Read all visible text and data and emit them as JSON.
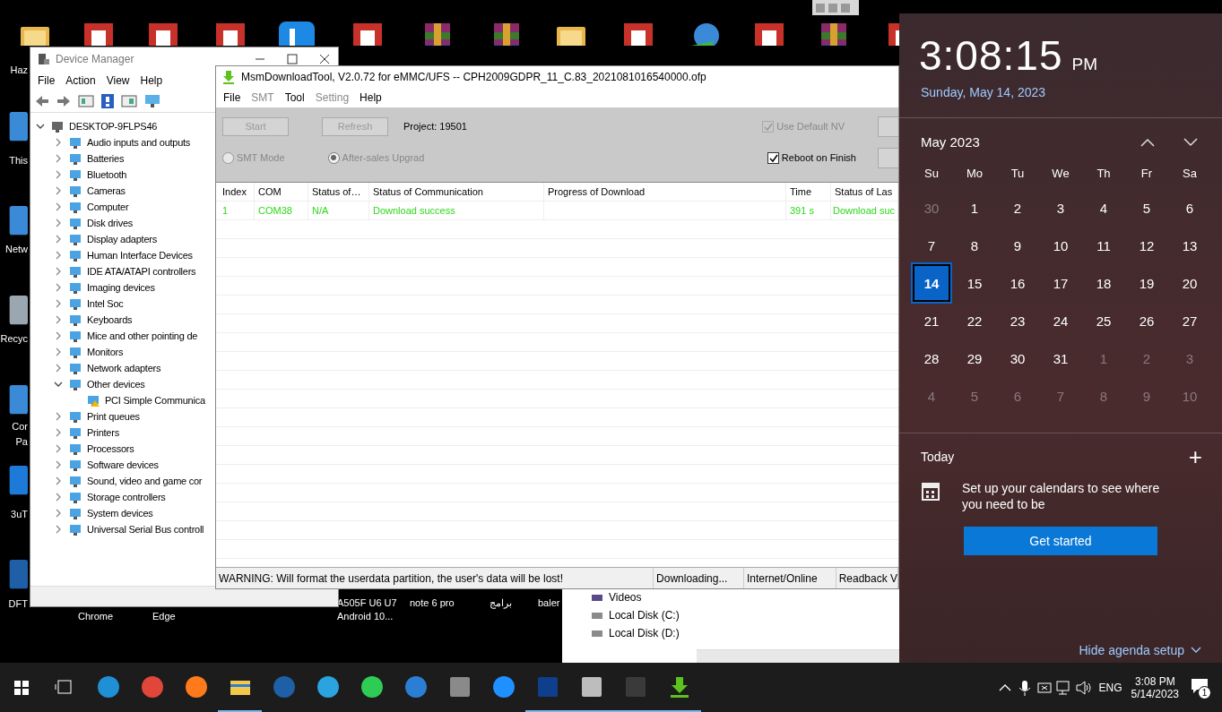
{
  "desktop": {
    "labels": [
      "Haz",
      "This",
      "Netw",
      "Recyc",
      "Cor",
      "Pa",
      "3uT",
      "DFT",
      "Chrome",
      "Edge",
      "A505F U6 U7",
      "Android 10...",
      "note 6 pro",
      "برامج",
      "baler"
    ]
  },
  "device_manager": {
    "title": "Device Manager",
    "menu": [
      "File",
      "Action",
      "View",
      "Help"
    ],
    "tree": [
      {
        "label": "DESKTOP-9FLPS46",
        "expanded": true,
        "children": [
          {
            "label": "Audio inputs and outputs",
            "expanded": false
          },
          {
            "label": "Batteries",
            "expanded": false
          },
          {
            "label": "Bluetooth",
            "expanded": false
          },
          {
            "label": "Cameras",
            "expanded": false
          },
          {
            "label": "Computer",
            "expanded": false
          },
          {
            "label": "Disk drives",
            "expanded": false
          },
          {
            "label": "Display adapters",
            "expanded": false
          },
          {
            "label": "Human Interface Devices",
            "expanded": false
          },
          {
            "label": "IDE ATA/ATAPI controllers",
            "expanded": false
          },
          {
            "label": "Imaging devices",
            "expanded": false
          },
          {
            "label": "Intel Soc",
            "expanded": false
          },
          {
            "label": "Keyboards",
            "expanded": false
          },
          {
            "label": "Mice and other pointing de",
            "expanded": false
          },
          {
            "label": "Monitors",
            "expanded": false
          },
          {
            "label": "Network adapters",
            "expanded": false
          },
          {
            "label": "Other devices",
            "expanded": true,
            "children": [
              {
                "label": "PCI Simple Communica",
                "warning": true
              }
            ]
          },
          {
            "label": "Print queues",
            "expanded": false
          },
          {
            "label": "Printers",
            "expanded": false
          },
          {
            "label": "Processors",
            "expanded": false
          },
          {
            "label": "Software devices",
            "expanded": false
          },
          {
            "label": "Sound, video and game cor",
            "expanded": false
          },
          {
            "label": "Storage controllers",
            "expanded": false
          },
          {
            "label": "System devices",
            "expanded": false
          },
          {
            "label": "Universal Serial Bus controll",
            "expanded": false
          }
        ]
      }
    ]
  },
  "msm_tool": {
    "title": "MsmDownloadTool, V2.0.72 for eMMC/UFS -- CPH2009GDPR_11_C.83_2021081016540000.ofp",
    "menu": [
      {
        "label": "File",
        "disabled": false
      },
      {
        "label": "SMT",
        "disabled": true
      },
      {
        "label": "Tool",
        "disabled": false
      },
      {
        "label": "Setting",
        "disabled": true
      },
      {
        "label": "Help",
        "disabled": false
      }
    ],
    "buttons": [
      {
        "label": "Start",
        "disabled": true
      },
      {
        "label": "Refresh",
        "disabled": true
      }
    ],
    "project": "Project: 19501",
    "use_default_nv": {
      "label": "Use Default NV",
      "checked": true,
      "disabled": true
    },
    "modes": [
      {
        "label": "SMT Mode",
        "selected": false
      },
      {
        "label": "After-sales Upgrad",
        "selected": true
      }
    ],
    "reboot_on_finish": {
      "label": "Reboot on Finish",
      "checked": true,
      "disabled": false
    },
    "table": {
      "columns": [
        "Index",
        "COM",
        "Status of…",
        "Status of Communication",
        "Progress of Download",
        "Time",
        "Status of Las"
      ],
      "rows": [
        {
          "cells": [
            "1",
            "COM38",
            "N/A",
            "Download success",
            "",
            "391 s",
            "Download suc"
          ]
        }
      ]
    },
    "status_bar": [
      "WARNING: Will format the userdata partition, the user's data will be lost!",
      "Downloading...",
      "Internet/Online",
      "Readback V"
    ]
  },
  "explorer": {
    "items": [
      "Videos",
      "Local Disk (C:)",
      "Local Disk (D:)"
    ]
  },
  "calendar_flyout": {
    "time": "3:08:15",
    "ampm": "PM",
    "date": "Sunday, May 14, 2023",
    "month": "May 2023",
    "weekdays": [
      "Su",
      "Mo",
      "Tu",
      "We",
      "Th",
      "Fr",
      "Sa"
    ],
    "weeks": [
      [
        {
          "label": "30",
          "in_month": false,
          "selected": false
        },
        {
          "label": "1",
          "in_month": true,
          "selected": false
        },
        {
          "label": "2",
          "in_month": true,
          "selected": false
        },
        {
          "label": "3",
          "in_month": true,
          "selected": false
        },
        {
          "label": "4",
          "in_month": true,
          "selected": false
        },
        {
          "label": "5",
          "in_month": true,
          "selected": false
        },
        {
          "label": "6",
          "in_month": true,
          "selected": false
        }
      ],
      [
        {
          "label": "7",
          "in_month": true,
          "selected": false
        },
        {
          "label": "8",
          "in_month": true,
          "selected": false
        },
        {
          "label": "9",
          "in_month": true,
          "selected": false
        },
        {
          "label": "10",
          "in_month": true,
          "selected": false
        },
        {
          "label": "11",
          "in_month": true,
          "selected": false
        },
        {
          "label": "12",
          "in_month": true,
          "selected": false
        },
        {
          "label": "13",
          "in_month": true,
          "selected": false
        }
      ],
      [
        {
          "label": "14",
          "in_month": true,
          "selected": true
        },
        {
          "label": "15",
          "in_month": true,
          "selected": false
        },
        {
          "label": "16",
          "in_month": true,
          "selected": false
        },
        {
          "label": "17",
          "in_month": true,
          "selected": false
        },
        {
          "label": "18",
          "in_month": true,
          "selected": false
        },
        {
          "label": "19",
          "in_month": true,
          "selected": false
        },
        {
          "label": "20",
          "in_month": true,
          "selected": false
        }
      ],
      [
        {
          "label": "21",
          "in_month": true,
          "selected": false
        },
        {
          "label": "22",
          "in_month": true,
          "selected": false
        },
        {
          "label": "23",
          "in_month": true,
          "selected": false
        },
        {
          "label": "24",
          "in_month": true,
          "selected": false
        },
        {
          "label": "25",
          "in_month": true,
          "selected": false
        },
        {
          "label": "26",
          "in_month": true,
          "selected": false
        },
        {
          "label": "27",
          "in_month": true,
          "selected": false
        }
      ],
      [
        {
          "label": "28",
          "in_month": true,
          "selected": false
        },
        {
          "label": "29",
          "in_month": true,
          "selected": false
        },
        {
          "label": "30",
          "in_month": true,
          "selected": false
        },
        {
          "label": "31",
          "in_month": true,
          "selected": false
        },
        {
          "label": "1",
          "in_month": false,
          "selected": false
        },
        {
          "label": "2",
          "in_month": false,
          "selected": false
        },
        {
          "label": "3",
          "in_month": false,
          "selected": false
        }
      ],
      [
        {
          "label": "4",
          "in_month": false,
          "selected": false
        },
        {
          "label": "5",
          "in_month": false,
          "selected": false
        },
        {
          "label": "6",
          "in_month": false,
          "selected": false
        },
        {
          "label": "7",
          "in_month": false,
          "selected": false
        },
        {
          "label": "8",
          "in_month": false,
          "selected": false
        },
        {
          "label": "9",
          "in_month": false,
          "selected": false
        },
        {
          "label": "10",
          "in_month": false,
          "selected": false
        }
      ]
    ],
    "today_label": "Today",
    "add": "+",
    "agenda_text": "Set up your calendars to see where you need to be",
    "get_started": "Get started",
    "hide_agenda": "Hide agenda setup"
  },
  "taskbar": {
    "apps": [
      {
        "kind": "edge",
        "open": false
      },
      {
        "kind": "chrome",
        "open": false
      },
      {
        "kind": "firefox",
        "open": false
      },
      {
        "kind": "explorer",
        "open": true
      },
      {
        "kind": "dft",
        "open": false
      },
      {
        "kind": "telegram",
        "open": false
      },
      {
        "kind": "whatsapp",
        "open": false
      },
      {
        "kind": "settings",
        "open": false
      },
      {
        "kind": "calculator",
        "open": false
      },
      {
        "kind": "remote",
        "open": false
      },
      {
        "kind": "teamviewer",
        "open": true
      },
      {
        "kind": "network",
        "open": true
      },
      {
        "kind": "mask",
        "open": true
      },
      {
        "kind": "download",
        "open": true
      }
    ],
    "language": "ENG",
    "time": "3:08 PM",
    "date": "5/14/2023",
    "notifications": "1"
  }
}
